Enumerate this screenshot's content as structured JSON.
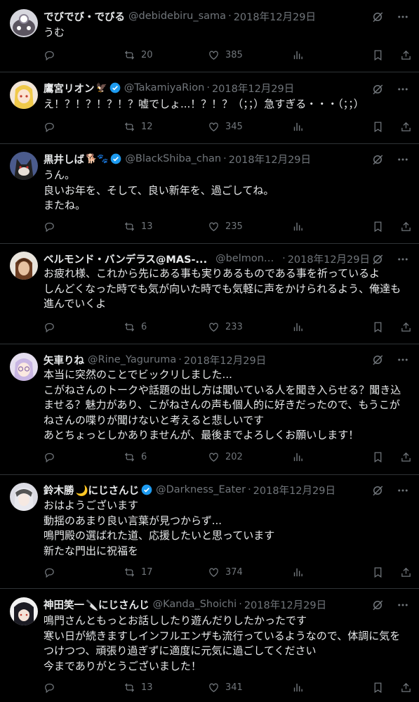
{
  "tweets": [
    {
      "name": "でびでび・でびる",
      "verified": false,
      "emoji": "",
      "handle": "@debidebiru_sama",
      "date": "2018年12月29日",
      "text": "うむ",
      "retweets": "20",
      "likes": "385"
    },
    {
      "name": "鷹宮リオン",
      "verified": true,
      "emoji": "🦅",
      "handle": "@TakamiyaRion",
      "date": "2018年12月29日",
      "text": "え！？！？！？！？嘘でしょ...！？！？（；；）急すぎる・・・（；；）",
      "retweets": "12",
      "likes": "345"
    },
    {
      "name": "黒井しば",
      "verified": true,
      "emoji": "🐕🐾",
      "handle": "@BlackShiba_chan",
      "date": "2018年12月29日",
      "text": "うん。\n良いお年を、そして、良い新年を、過ごしてね。\nまたね。",
      "retweets": "13",
      "likes": "235"
    },
    {
      "name": "ベルモンド・バンデラス@MAS-...",
      "verified": false,
      "emoji": "",
      "handle": "@belmond_...",
      "date": "2018年12月29日",
      "text": "お疲れ様、これから先にある事も実りあるものである事を祈っているよ\nしんどくなった時でも気が向いた時でも気軽に声をかけられるよう、俺達も\n進んでいくよ",
      "retweets": "6",
      "likes": "233"
    },
    {
      "name": "矢車りね",
      "verified": false,
      "emoji": "",
      "handle": "@Rine_Yaguruma",
      "date": "2018年12月29日",
      "text": "本当に突然のことでビックリしました...\nこがねさんのトークや話題の出し方は聞いている人を聞き入らせる？聞き込\nませる？魅力があり、こがねさんの声も個人的に好きだったので、もうこが\nねさんの喋りが聞けないと考えると悲しいです\nあとちょっとしかありませんが、最後までよろしくお願いします！",
      "retweets": "6",
      "likes": "202"
    },
    {
      "name": "鈴木勝",
      "verified": true,
      "emoji": "🌙にじさんじ",
      "handle": "@Darkness_Eater",
      "date": "2018年12月29日",
      "text": "おはようございます\n動揺のあまり良い言葉が見つからず...\n鳴門殿の選ばれた道、応援したいと思っています\n新たな門出に祝福を",
      "retweets": "17",
      "likes": "374"
    },
    {
      "name": "神田笑一",
      "verified": false,
      "emoji": "🔪にじさんじ",
      "handle": "@Kanda_Shoichi",
      "date": "2018年12月29日",
      "text": "鳴門さんともっとお話ししたり遊んだりしたかったです\n寒い日が続きますしインフルエンザも流行っているようなので、体調に気を\nつけつつ、頑張り過ぎずに適度に元気に過ごしてください\n今までありがとうございました！",
      "retweets": "13",
      "likes": "341"
    }
  ],
  "colors": {
    "background": "#000000",
    "text": "#e7e9ea",
    "muted": "#71767b",
    "verified": "#1d9bf0",
    "divider": "#2f3336"
  },
  "icons": {
    "reply": "reply-icon",
    "retweet": "retweet-icon",
    "like": "like-icon",
    "views": "views-icon",
    "bookmark": "bookmark-icon",
    "share": "share-icon",
    "grok": "grok-icon",
    "more": "more-icon"
  }
}
